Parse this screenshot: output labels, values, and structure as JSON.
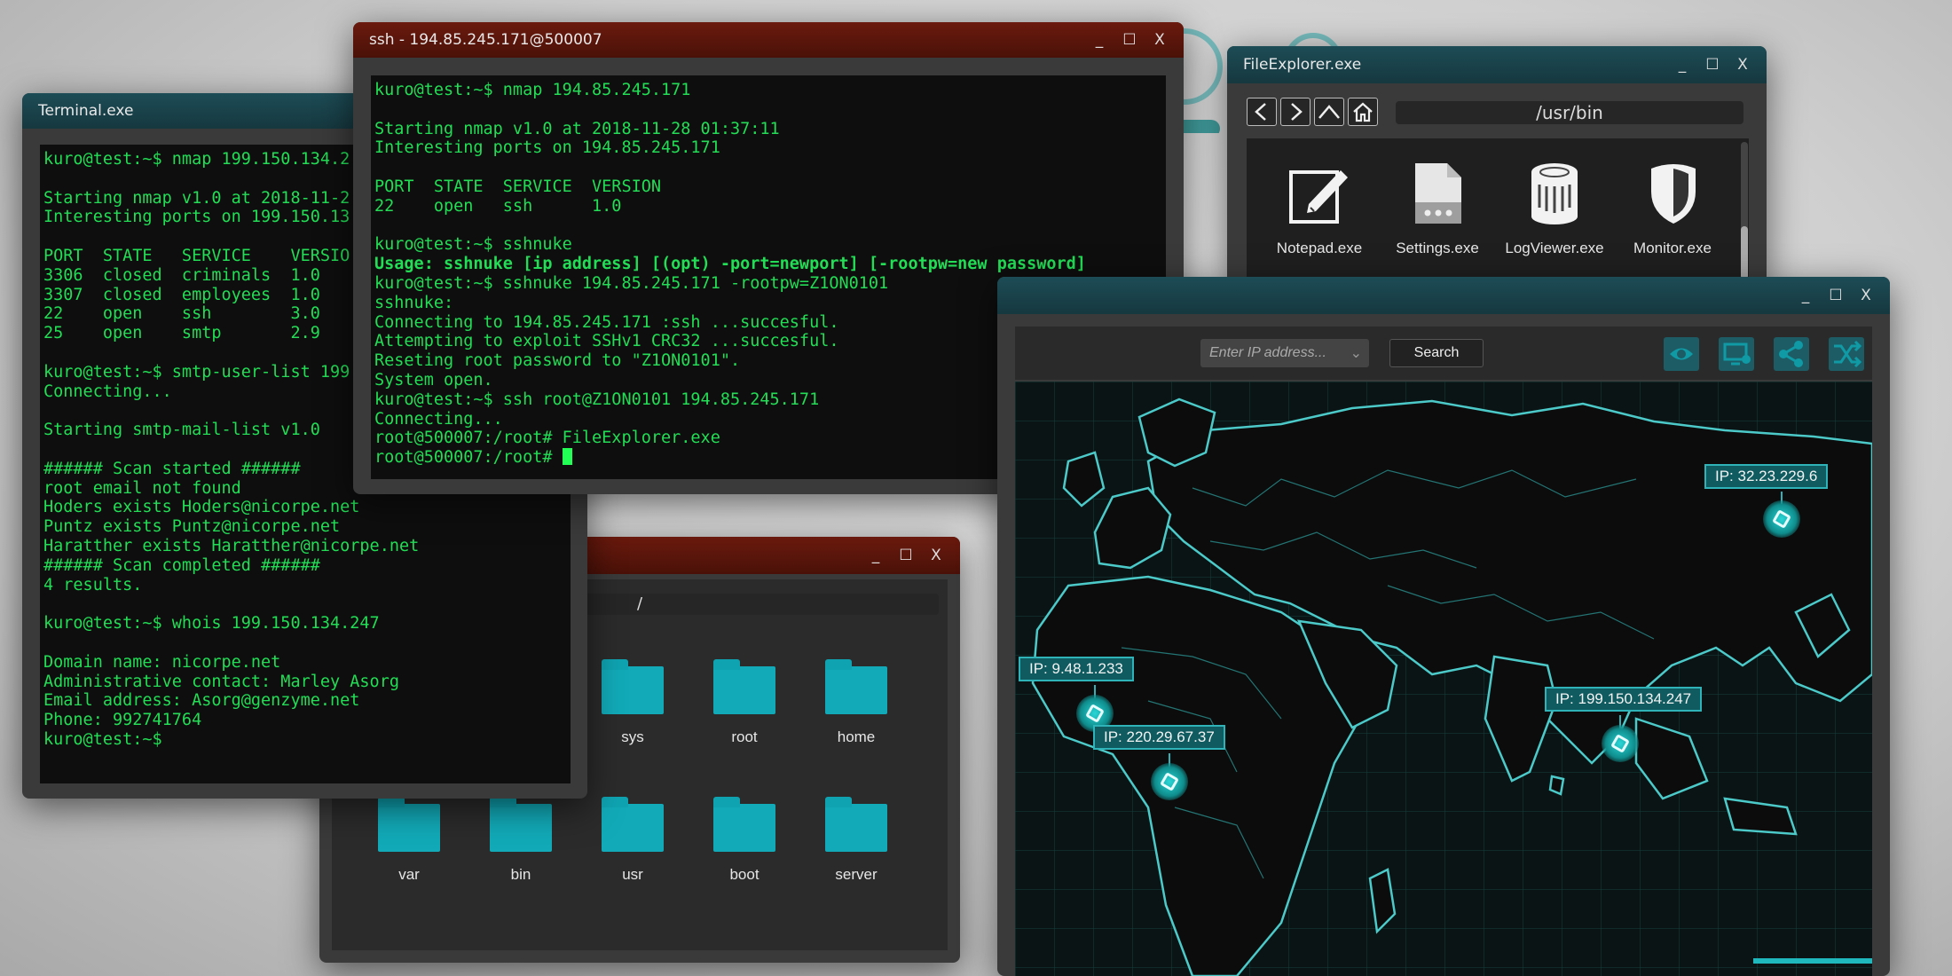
{
  "terminal_left": {
    "title": "Terminal.exe",
    "lines": [
      "kuro@test:~$ nmap 199.150.134.2",
      "",
      "Starting nmap v1.0 at 2018-11-2",
      "Interesting ports on 199.150.13",
      "",
      "PORT  STATE   SERVICE    VERSIO",
      "3306  closed  criminals  1.0",
      "3307  closed  employees  1.0",
      "22    open    ssh        3.0",
      "25    open    smtp       2.9",
      "",
      "kuro@test:~$ smtp-user-list 199",
      "Connecting...",
      "",
      "Starting smtp-mail-list v1.0",
      "",
      "###### Scan started ######",
      "root email not found",
      "Hoders exists Hoders@nicorpe.net",
      "Puntz exists Puntz@nicorpe.net",
      "Haratther exists Haratther@nicorpe.net",
      "###### Scan completed ######",
      "4 results.",
      "",
      "kuro@test:~$ whois 199.150.134.247",
      "",
      "Domain name: nicorpe.net",
      "Administrative contact: Marley Asorg",
      "Email address: Asorg@genzyme.net",
      "Phone: 992741764",
      "kuro@test:~$"
    ]
  },
  "ssh_terminal": {
    "title": "ssh - 194.85.245.171@500007",
    "lines": [
      "kuro@test:~$ nmap 194.85.245.171",
      "",
      "Starting nmap v1.0 at 2018-11-28 01:37:11",
      "Interesting ports on 194.85.245.171",
      "",
      "PORT  STATE  SERVICE  VERSION",
      "22    open   ssh      1.0",
      "",
      "kuro@test:~$ sshnuke",
      "Usage: sshnuke [ip address] [(opt) -port=newport] [-rootpw=new password]",
      "kuro@test:~$ sshnuke 194.85.245.171 -rootpw=Z1ON0101",
      "sshnuke:",
      "Connecting to 194.85.245.171 :ssh ...succesful.",
      "Attempting to exploit SSHv1 CRC32 ...succesful.",
      "Reseting root password to \"Z1ON0101\".",
      "System open.",
      "kuro@test:~$ ssh root@Z1ON0101 194.85.245.171",
      "Connecting...",
      "root@500007:/root# FileExplorer.exe",
      "root@500007:/root# "
    ]
  },
  "file_explorer_top": {
    "title": "FileExplorer.exe",
    "path": "/usr/bin",
    "items": [
      {
        "label": "Notepad.exe",
        "icon": "notepad-icon"
      },
      {
        "label": "Settings.exe",
        "icon": "settings-file-icon"
      },
      {
        "label": "LogViewer.exe",
        "icon": "logviewer-icon"
      },
      {
        "label": "Monitor.exe",
        "icon": "shield-icon"
      }
    ]
  },
  "file_explorer_bottom": {
    "path": "/",
    "folders_row1": [
      "sys",
      "root",
      "home"
    ],
    "folders_row2": [
      "var",
      "bin",
      "usr",
      "boot",
      "server"
    ]
  },
  "map_window": {
    "ip_placeholder": "Enter IP address...",
    "search_label": "Search",
    "tool_icons": [
      "eye-icon",
      "monitor-plus-icon",
      "share-icon",
      "shuffle-icon"
    ],
    "markers": [
      {
        "label": "IP: 32.23.229.6"
      },
      {
        "label": "IP: 9.48.1.233"
      },
      {
        "label": "IP: 220.29.67.37"
      },
      {
        "label": "IP: 199.150.134.247"
      }
    ]
  },
  "colors": {
    "terminal_text": "#22dd55",
    "accent_teal": "#12aab8",
    "ssh_titlebar": "#6b1a0e",
    "teal_titlebar": "#1d4c56"
  }
}
